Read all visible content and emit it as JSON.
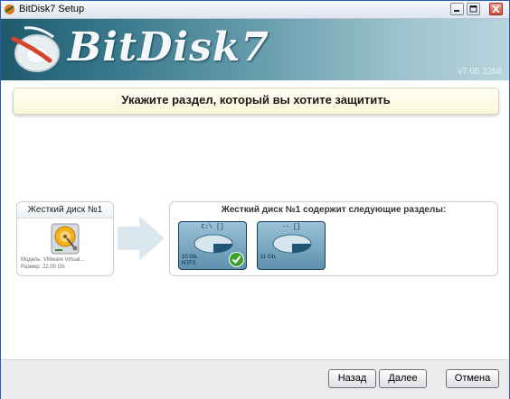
{
  "window": {
    "title": "BitDisk7 Setup"
  },
  "banner": {
    "logo_text": "BitDisk7",
    "version": "v7.05 32bit"
  },
  "instruction": "Укажите раздел, который вы хотите защитить",
  "disk": {
    "title": "Жесткий диск №1",
    "model": "Модель: VMware Virtual...",
    "size": "Размер: 22.00 Gb"
  },
  "partitions": {
    "title": "Жесткий диск №1 содержит следующие разделы:",
    "items": [
      {
        "label": "C:\\ []",
        "size": "10 Gb,",
        "fs": "NTFS",
        "selected": true
      },
      {
        "label": "-- []",
        "size": "11 Gb,",
        "fs": "",
        "selected": false
      }
    ]
  },
  "buttons": {
    "back": "Назад",
    "next": "Далее",
    "cancel": "Отмена"
  },
  "colors": {
    "banner": "#3d7c8f",
    "instruction_bg": "#fbf7d9",
    "check": "#3aa12a"
  }
}
